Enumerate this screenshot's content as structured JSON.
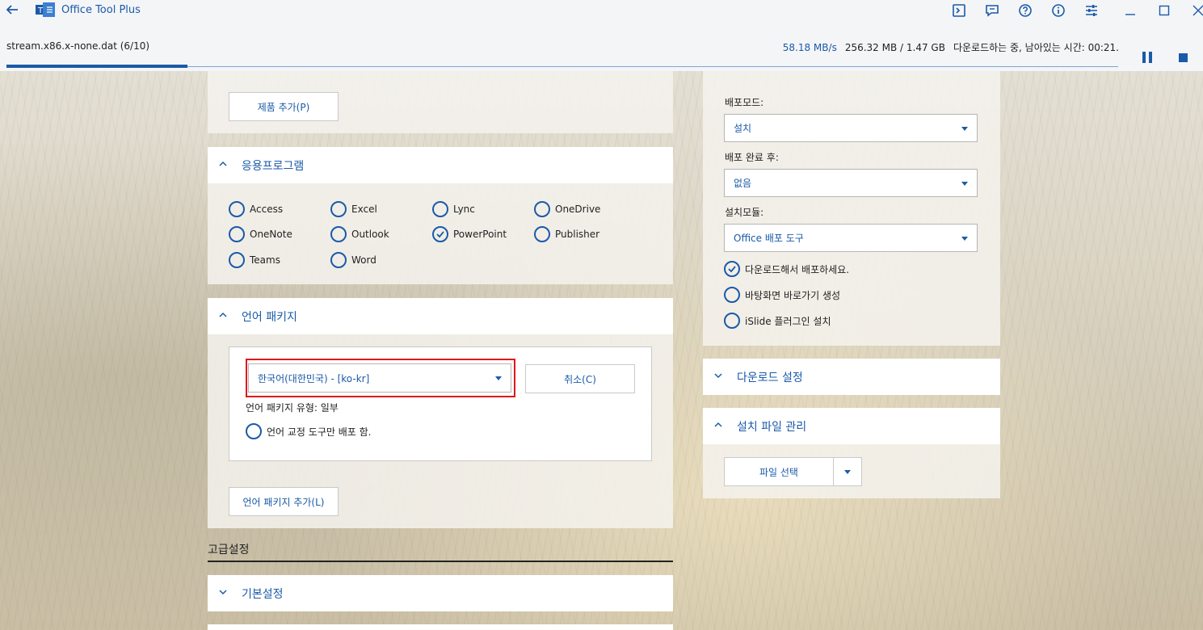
{
  "titlebar": {
    "title": "Office Tool Plus",
    "logo_text": "T",
    "icons": [
      "console-icon",
      "feedback-icon",
      "help-icon",
      "info-icon",
      "settings-icon"
    ],
    "window_controls": [
      "minimize-icon",
      "maximize-icon",
      "close-icon"
    ]
  },
  "download": {
    "file": "stream.x86.x-none.dat (6/10)",
    "speed": "58.18 MB/s",
    "size": "256.32 MB / 1.47 GB",
    "status": "다운로드하는 중, 남아있는 시간: 00:21.",
    "progress": 0.163
  },
  "left": {
    "add_product": "제품 추가(P)",
    "apps": {
      "title": "응용프로그램",
      "items": [
        {
          "label": "Access",
          "checked": false
        },
        {
          "label": "Excel",
          "checked": false
        },
        {
          "label": "Lync",
          "checked": false
        },
        {
          "label": "OneDrive",
          "checked": false
        },
        {
          "label": "OneNote",
          "checked": false
        },
        {
          "label": "Outlook",
          "checked": false
        },
        {
          "label": "PowerPoint",
          "checked": true
        },
        {
          "label": "Publisher",
          "checked": false
        },
        {
          "label": "Teams",
          "checked": false
        },
        {
          "label": "Word",
          "checked": false
        }
      ]
    },
    "lang": {
      "title": "언어 패키지",
      "selected": "한국어(대한민국) - [ko-kr]",
      "cancel": "취소(C)",
      "type_label": "언어 패키지 유형: 일부",
      "proofing": "언어 교정 도구만 배포 함.",
      "add": "언어 패키지 추가(L)"
    },
    "advanced": "고급설정",
    "basic": "기본설정"
  },
  "right": {
    "deploy_mode_label": "배포모드:",
    "deploy_mode": "설치",
    "after_label": "배포 완료 후:",
    "after": "없음",
    "module_label": "설치모듈:",
    "module": "Office 배포 도구",
    "options": [
      {
        "label": "다운로드해서 배포하세요.",
        "checked": true
      },
      {
        "label": "바탕화면 바로가기 생성",
        "checked": false
      },
      {
        "label": "iSlide 플러그인 설치",
        "checked": false
      }
    ],
    "download_settings": "다운로드 설정",
    "file_mgmt": "설치 파일 관리",
    "file_select": "파일 선택"
  },
  "colors": {
    "accent": "#1a5aa8",
    "highlight": "#e0161c"
  }
}
